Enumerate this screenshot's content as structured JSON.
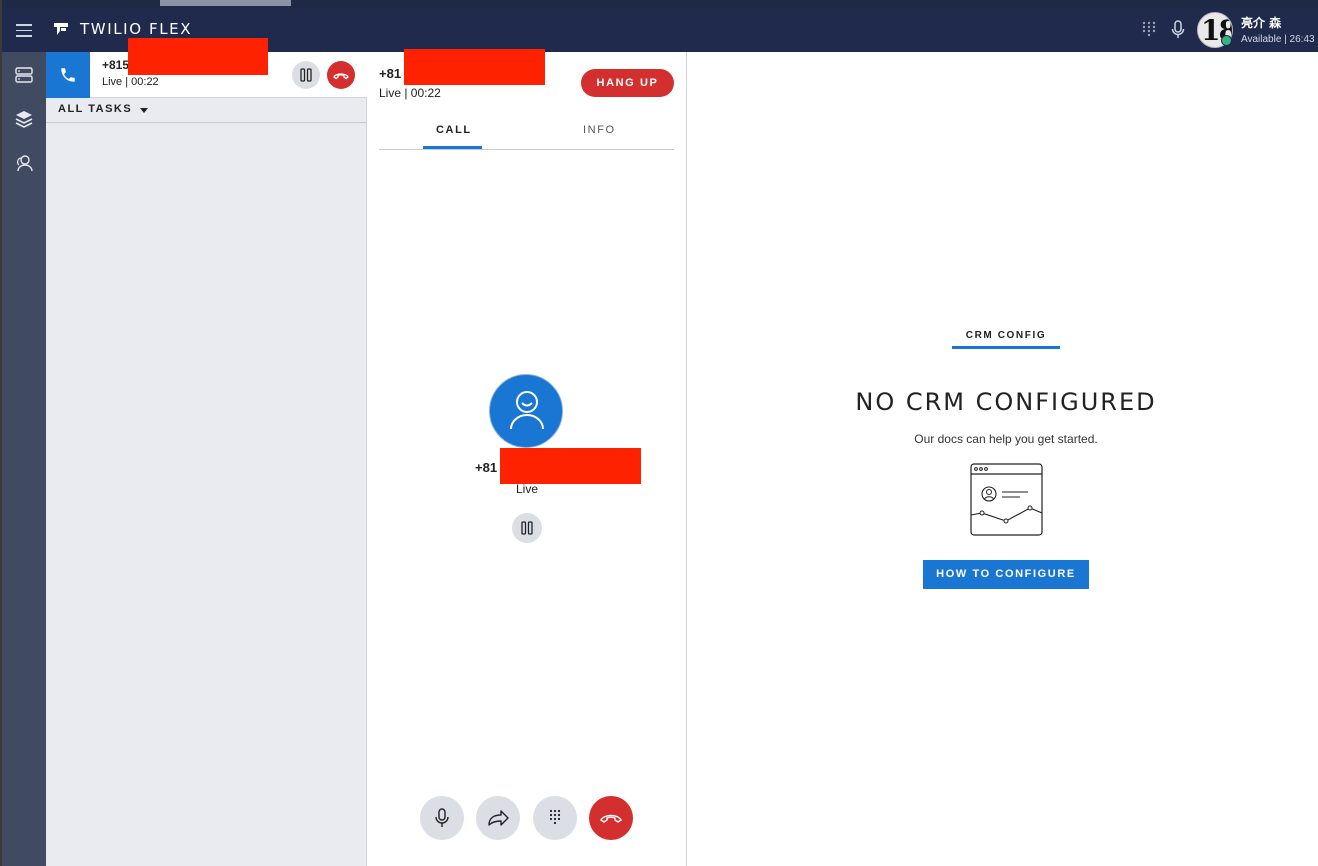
{
  "header": {
    "brand": "TWILIO FLEX",
    "user_name": "亮介 森",
    "user_status": "Available | 26:43",
    "avatar_text": "18"
  },
  "rail": {
    "items": [
      {
        "icon": "agent-desktop-icon"
      },
      {
        "icon": "teams-layers-icon"
      },
      {
        "icon": "supervisor-icon"
      }
    ]
  },
  "task_list": {
    "task": {
      "title": "+815",
      "subtitle": "Live | 00:22"
    },
    "filter_label": "ALL TASKS"
  },
  "call": {
    "number": "+81",
    "status": "Live | 00:22",
    "hangup_label": "HANG UP",
    "tabs": [
      "CALL",
      "INFO"
    ],
    "active_tab": "CALL",
    "caller_number": "+81",
    "caller_status": "Live"
  },
  "crm": {
    "tab_label": "CRM CONFIG",
    "title": "NO CRM CONFIGURED",
    "subtitle": "Our docs can help you get started.",
    "button_label": "HOW TO CONFIGURE"
  },
  "colors": {
    "header_bg": "#1f2a4d",
    "rail_bg": "#404a60",
    "accent": "#1976d2",
    "danger": "#d32f2f",
    "available": "#36b37e"
  }
}
